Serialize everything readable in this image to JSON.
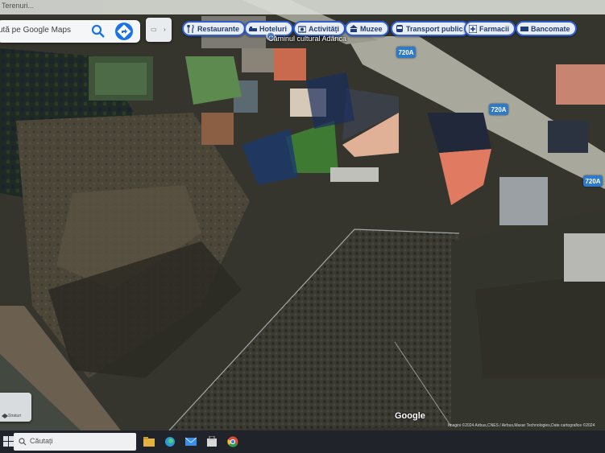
{
  "browser": {
    "tab_title": "Terenuri..."
  },
  "search": {
    "placeholder": "ută pe Google Maps"
  },
  "layer_button": {
    "label": ""
  },
  "chips": [
    {
      "label": "Restaurante",
      "icon": "fork-knife-icon"
    },
    {
      "label": "Hoteluri",
      "icon": "bed-icon"
    },
    {
      "label": "Activități",
      "icon": "camera-icon"
    },
    {
      "label": "Muzee",
      "icon": "museum-icon"
    },
    {
      "label": "Transport public",
      "icon": "bus-icon"
    },
    {
      "label": "Farmacii",
      "icon": "pharmacy-icon"
    },
    {
      "label": "Bancomate",
      "icon": "atm-icon"
    }
  ],
  "place": {
    "label": "Căminul cultural Adânca"
  },
  "road_shields": [
    "720A",
    "720A",
    "720A"
  ],
  "google_logo": "Google",
  "attribution": "Imagini ©2024 Airbus,CNES / Airbus,Maxar Technologies,Date cartografice ©2024",
  "street_view": {
    "label": "Straturi"
  },
  "taskbar": {
    "search_placeholder": "Căutați"
  },
  "colors": {
    "chip_border": "#2f5fd6",
    "shield": "#2f7ac8",
    "search_blue": "#1a73e8"
  }
}
